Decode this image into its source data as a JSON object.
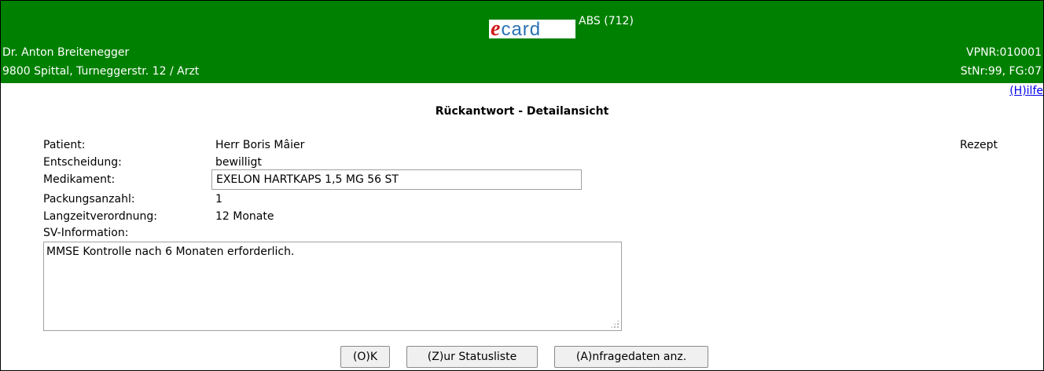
{
  "header": {
    "logo": {
      "e": "e",
      "rest": "card"
    },
    "system_title": "ABS (712)",
    "doctor_name": "Dr. Anton Breitenegger",
    "address": "9800 Spittal, Turneggerstr. 12 / Arzt",
    "vpnr": "VPNR:010001",
    "stnr": "StNr:99, FG:07",
    "background_color": "#008000"
  },
  "help_link": "(H)ilfe",
  "page_title": "Rückantwort - Detailansicht",
  "doc_type": "Rezept",
  "fields": {
    "patient_label": "Patient:",
    "patient_value": "Herr Boris Mâier",
    "entscheidung_label": "Entscheidung:",
    "entscheidung_value": "bewilligt",
    "medikament_label": "Medikament:",
    "medikament_value": "EXELON HARTKAPS 1,5 MG 56 ST",
    "packungsanzahl_label": "Packungsanzahl:",
    "packungsanzahl_value": "1",
    "langzeit_label": "Langzeitverordnung:",
    "langzeit_value": "12 Monate",
    "sv_label": "SV-Information:",
    "sv_value": "MMSE Kontrolle nach 6 Monaten erforderlich."
  },
  "buttons": {
    "ok": "(O)K",
    "statusliste": "(Z)ur Statusliste",
    "anfragedaten": "(A)nfragedaten anz."
  }
}
